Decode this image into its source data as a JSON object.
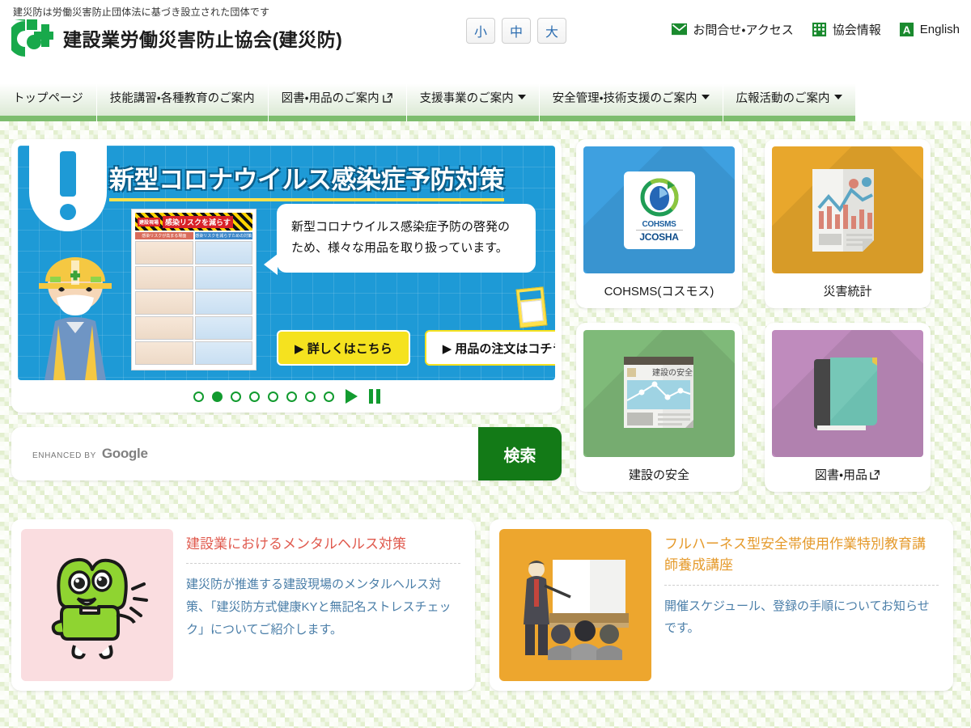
{
  "header": {
    "tagline": "建災防は労働災害防止団体法に基づき設立された団体です",
    "brand_name": "建設業労働災害防止協会(建災防)",
    "logo_icon": "kensaibo-cross-logo",
    "font_sizes": [
      {
        "label": "小",
        "name": "font-size-small"
      },
      {
        "label": "中",
        "name": "font-size-medium"
      },
      {
        "label": "大",
        "name": "font-size-large"
      }
    ],
    "links": [
      {
        "label": "お問合せ・アクセス",
        "icon": "mail-icon",
        "color": "#1a8a2e"
      },
      {
        "label": "協会情報",
        "icon": "building-icon",
        "color": "#1a8a2e"
      },
      {
        "label": "English",
        "icon": "letter-a-icon",
        "color": "#1a8a2e"
      }
    ]
  },
  "nav": {
    "items": [
      {
        "label": "トップページ",
        "has_caret": false,
        "external": false
      },
      {
        "label": "技能講習・各種教育のご案内",
        "has_caret": false,
        "external": false
      },
      {
        "label": "図書・用品のご案内",
        "has_caret": false,
        "external": true
      },
      {
        "label": "支援事業のご案内",
        "has_caret": true,
        "external": false
      },
      {
        "label": "安全管理・技術支援のご案内",
        "has_caret": true,
        "external": false
      },
      {
        "label": "広報活動のご案内",
        "has_caret": true,
        "external": false
      }
    ]
  },
  "carousel": {
    "slide": {
      "title": "新型コロナウイルス感染症予防対策",
      "bubble_text": "新型コロナウイルス感染症予防の啓発のため、様々な用品を取り扱っています。",
      "poster_heading": "感染リスクを減らす",
      "poster_badge": "建設現場",
      "poster_col_left": "感染リスクが高まる場面",
      "poster_col_right": "感染リスクを減らすための対策",
      "cta_primary": "▶ 詳しくはこちら",
      "cta_secondary": "▶ 用品の注文はコチラ"
    },
    "dot_count": 8,
    "active_dot": 2,
    "play_label": "play-button",
    "pause_label": "pause-button"
  },
  "search": {
    "enhanced_by": "ENHANCED BY",
    "provider": "Google",
    "placeholder": "",
    "value": "",
    "button_label": "検索",
    "button_color": "#137a17"
  },
  "tiles": [
    {
      "caption": "COHSMS(コスモス)",
      "bg": "blue",
      "icon": "cohsms-logo-icon",
      "external": false,
      "logo_top": "COHSMS",
      "logo_bottom": "JCOSHA"
    },
    {
      "caption": "災害統計",
      "bg": "orange",
      "icon": "statistics-document-icon",
      "external": false
    },
    {
      "caption": "建設の安全",
      "bg": "green",
      "icon": "magazine-icon",
      "external": false,
      "cover_title": "建設の安全"
    },
    {
      "caption": "図書・用品",
      "bg": "purple",
      "icon": "book-icon",
      "external": true
    }
  ],
  "info_cards": [
    {
      "title": "建設業におけるメンタルヘルス対策",
      "text": "建災防が推進する建設現場のメンタルヘルス対策、「建災防方式健康KYと無記名ストレスチェック」についてご紹介します。",
      "thumb": "pink",
      "thumb_icon": "green-mascot-character",
      "title_color": "#e05a4e"
    },
    {
      "title": "フルハーネス型安全帯使用作業特別教育講師養成講座",
      "text": "開催スケジュール、登録の手順についてお知らせです。",
      "thumb": "amber",
      "thumb_icon": "classroom-lecture-icon",
      "title_color": "#e59a2b"
    }
  ]
}
